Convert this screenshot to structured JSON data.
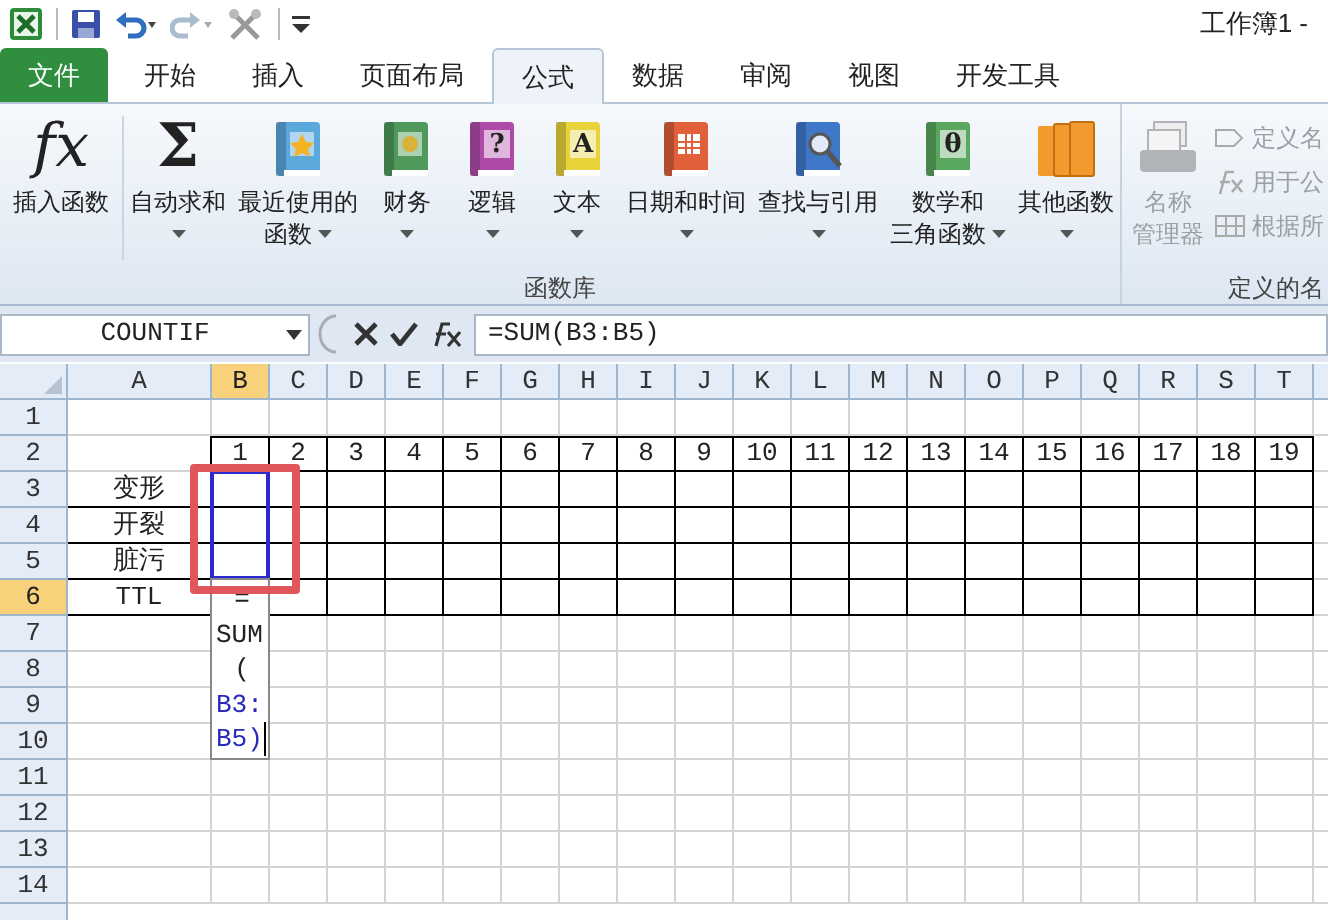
{
  "window": {
    "title": "工作簿1 -"
  },
  "tabs": [
    {
      "label": "文件",
      "kind": "file",
      "selected": false
    },
    {
      "label": "开始",
      "kind": "tab",
      "selected": false
    },
    {
      "label": "插入",
      "kind": "tab",
      "selected": false
    },
    {
      "label": "页面布局",
      "kind": "tab",
      "selected": false
    },
    {
      "label": "公式",
      "kind": "tab",
      "selected": true
    },
    {
      "label": "数据",
      "kind": "tab",
      "selected": false
    },
    {
      "label": "审阅",
      "kind": "tab",
      "selected": false
    },
    {
      "label": "视图",
      "kind": "tab",
      "selected": false
    },
    {
      "label": "开发工具",
      "kind": "tab",
      "selected": false
    }
  ],
  "ribbon": {
    "groups": [
      {
        "label": "函数库",
        "disabled": false,
        "buttons": [
          {
            "lines": [
              "插入函数"
            ],
            "dropdown": false,
            "icon": {
              "kind": "glyph",
              "glyph": "fx"
            }
          },
          {
            "lines": [
              "自动求和"
            ],
            "dropdown": true,
            "icon": {
              "kind": "glyph",
              "glyph": "Σ"
            }
          },
          {
            "lines": [
              "最近使用的",
              "函数"
            ],
            "dropdown": true,
            "icon": {
              "kind": "book",
              "color": "#5aa8dc"
            }
          },
          {
            "lines": [
              "财务"
            ],
            "dropdown": true,
            "icon": {
              "kind": "book",
              "color": "#4f9a5a"
            }
          },
          {
            "lines": [
              "逻辑"
            ],
            "dropdown": true,
            "icon": {
              "kind": "book",
              "color": "#b04aa8",
              "glyph": "?"
            }
          },
          {
            "lines": [
              "文本"
            ],
            "dropdown": true,
            "icon": {
              "kind": "book",
              "color": "#e8d43a",
              "glyph": "A"
            }
          },
          {
            "lines": [
              "日期和时间"
            ],
            "dropdown": true,
            "icon": {
              "kind": "book",
              "color": "#e0603a"
            }
          },
          {
            "lines": [
              "查找与引用"
            ],
            "dropdown": true,
            "icon": {
              "kind": "book",
              "color": "#3f78c8"
            }
          },
          {
            "lines": [
              "数学和",
              "三角函数"
            ],
            "dropdown": true,
            "icon": {
              "kind": "book",
              "color": "#5aa860",
              "glyph": "θ"
            }
          },
          {
            "lines": [
              "其他函数"
            ],
            "dropdown": true,
            "icon": {
              "kind": "books",
              "color": "#f29a2e"
            }
          }
        ]
      },
      {
        "label": "定义的名",
        "disabled": true,
        "buttons": [
          {
            "lines": [
              "名称",
              "管理器"
            ],
            "dropdown": false,
            "icon": {
              "kind": "cards",
              "color": "#b0b4b8"
            }
          }
        ],
        "small_buttons": [
          {
            "label": "定义名"
          },
          {
            "label": "用于公"
          },
          {
            "label": "根据所"
          }
        ]
      }
    ]
  },
  "formula_bar": {
    "name_box": "COUNTIF",
    "formula": "=SUM(B3:B5)"
  },
  "sheet": {
    "columns": [
      {
        "label": "A",
        "selected": false
      },
      {
        "label": "B",
        "selected": true
      },
      {
        "label": "C",
        "selected": false
      },
      {
        "label": "D",
        "selected": false
      },
      {
        "label": "E",
        "selected": false
      },
      {
        "label": "F",
        "selected": false
      },
      {
        "label": "G",
        "selected": false
      },
      {
        "label": "H",
        "selected": false
      },
      {
        "label": "I",
        "selected": false
      },
      {
        "label": "J",
        "selected": false
      },
      {
        "label": "K",
        "selected": false
      },
      {
        "label": "L",
        "selected": false
      },
      {
        "label": "M",
        "selected": false
      },
      {
        "label": "N",
        "selected": false
      },
      {
        "label": "O",
        "selected": false
      },
      {
        "label": "P",
        "selected": false
      },
      {
        "label": "Q",
        "selected": false
      },
      {
        "label": "R",
        "selected": false
      },
      {
        "label": "S",
        "selected": false
      },
      {
        "label": "T",
        "selected": false
      }
    ],
    "rows": [
      {
        "label": "1",
        "selected": false,
        "bordered": false,
        "cells": []
      },
      {
        "label": "2",
        "selected": false,
        "bordered": true,
        "cells": [
          null,
          "1",
          "2",
          "3",
          "4",
          "5",
          "6",
          "7",
          "8",
          "9",
          "10",
          "11",
          "12",
          "13",
          "14",
          "15",
          "16",
          "17",
          "18",
          "19"
        ]
      },
      {
        "label": "3",
        "selected": false,
        "bordered": true,
        "cells": [
          "变形"
        ]
      },
      {
        "label": "4",
        "selected": false,
        "bordered": true,
        "cells": [
          "开裂"
        ]
      },
      {
        "label": "5",
        "selected": false,
        "bordered": true,
        "cells": [
          "脏污"
        ]
      },
      {
        "label": "6",
        "selected": true,
        "bordered": true,
        "cells": [
          "TTL"
        ]
      },
      {
        "label": "7",
        "selected": false,
        "bordered": false,
        "cells": []
      },
      {
        "label": "8",
        "selected": false,
        "bordered": false,
        "cells": []
      },
      {
        "label": "9",
        "selected": false,
        "bordered": false,
        "cells": []
      },
      {
        "label": "10",
        "selected": false,
        "bordered": false,
        "cells": []
      },
      {
        "label": "11",
        "selected": false,
        "bordered": false,
        "cells": []
      },
      {
        "label": "12",
        "selected": false,
        "bordered": false,
        "cells": []
      },
      {
        "label": "13",
        "selected": false,
        "bordered": false,
        "cells": []
      },
      {
        "label": "14",
        "selected": false,
        "bordered": false,
        "cells": []
      }
    ],
    "annotation": {
      "kind": "frame"
    },
    "cell_editor": {
      "lines": [
        {
          "text": "=",
          "kind": "plain"
        },
        {
          "text": "SUM",
          "kind": "plain"
        },
        {
          "text": "(",
          "kind": "plain"
        },
        {
          "text": "B3:",
          "kind": "ref"
        },
        {
          "text": "B5)",
          "kind": "ref"
        }
      ]
    }
  }
}
